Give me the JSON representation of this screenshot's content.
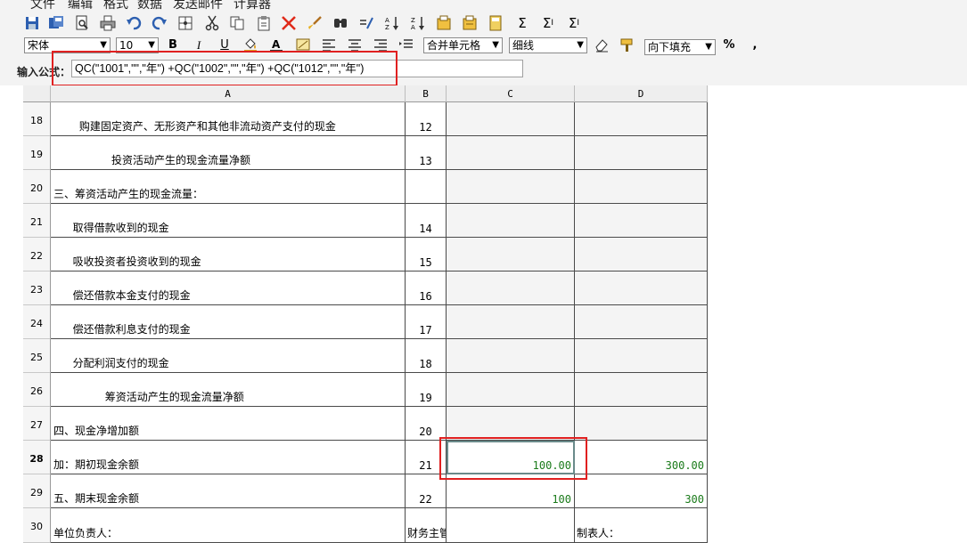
{
  "menu": [
    "文件",
    "编辑",
    "格式",
    "数据",
    "发送邮件",
    "计算器"
  ],
  "toolbar_icons": [
    "save-icon",
    "save-as-icon",
    "print-preview-icon",
    "print-icon",
    "undo-icon",
    "redo-icon",
    "grid-icon",
    "cut-icon",
    "copy-icon",
    "paste-icon",
    "delete-icon",
    "brush-icon",
    "find-icon",
    "formula-edit-icon",
    "sort-asc-icon",
    "sort-desc-icon",
    "chart-icon",
    "chart2-icon",
    "calc-icon",
    "sum-icon",
    "sum-row-icon",
    "sum-col-icon"
  ],
  "format": {
    "font_name": "宋体",
    "font_size": "10",
    "bold": "B",
    "italic": "I",
    "underline": "U",
    "merge": "合并单元格",
    "border": "细线",
    "fill": "向下填充",
    "percent": "%",
    "comma": ","
  },
  "formula": {
    "label": "输入公式：",
    "value": "QC(\"1001\",\"\",\"年\") +QC(\"1002\",\"\",\"年\") +QC(\"1012\",\"\",\"年\")"
  },
  "columns": [
    "A",
    "B",
    "C",
    "D"
  ],
  "rows": [
    {
      "num": "18",
      "a": "    购建固定资产、无形资产和其他非流动资产支付的现金",
      "b": "12",
      "c": "",
      "d": ""
    },
    {
      "num": "19",
      "a": "         投资活动产生的现金流量净额",
      "b": "13",
      "c": "",
      "d": ""
    },
    {
      "num": "20",
      "a": "三、筹资活动产生的现金流量：",
      "b": "",
      "c": "",
      "d": ""
    },
    {
      "num": "21",
      "a": "   取得借款收到的现金",
      "b": "14",
      "c": "",
      "d": ""
    },
    {
      "num": "22",
      "a": "   吸收投资者投资收到的现金",
      "b": "15",
      "c": "",
      "d": ""
    },
    {
      "num": "23",
      "a": "   偿还借款本金支付的现金",
      "b": "16",
      "c": "",
      "d": ""
    },
    {
      "num": "24",
      "a": "   偿还借款利息支付的现金",
      "b": "17",
      "c": "",
      "d": ""
    },
    {
      "num": "25",
      "a": "   分配利润支付的现金",
      "b": "18",
      "c": "",
      "d": ""
    },
    {
      "num": "26",
      "a": "        筹资活动产生的现金流量净额",
      "b": "19",
      "c": "",
      "d": ""
    },
    {
      "num": "27",
      "a": "四、现金净增加额",
      "b": "20",
      "c": "",
      "d": ""
    },
    {
      "num": "28",
      "a": "加：期初现金余额",
      "b": "21",
      "c": "100.00",
      "d": "300.00"
    },
    {
      "num": "29",
      "a": "五、期末现金余额",
      "b": "22",
      "c": "100",
      "d": "300"
    },
    {
      "num": "30",
      "a": "单位负责人：",
      "b": "财务主管：",
      "c": "",
      "d": "制表人："
    }
  ]
}
